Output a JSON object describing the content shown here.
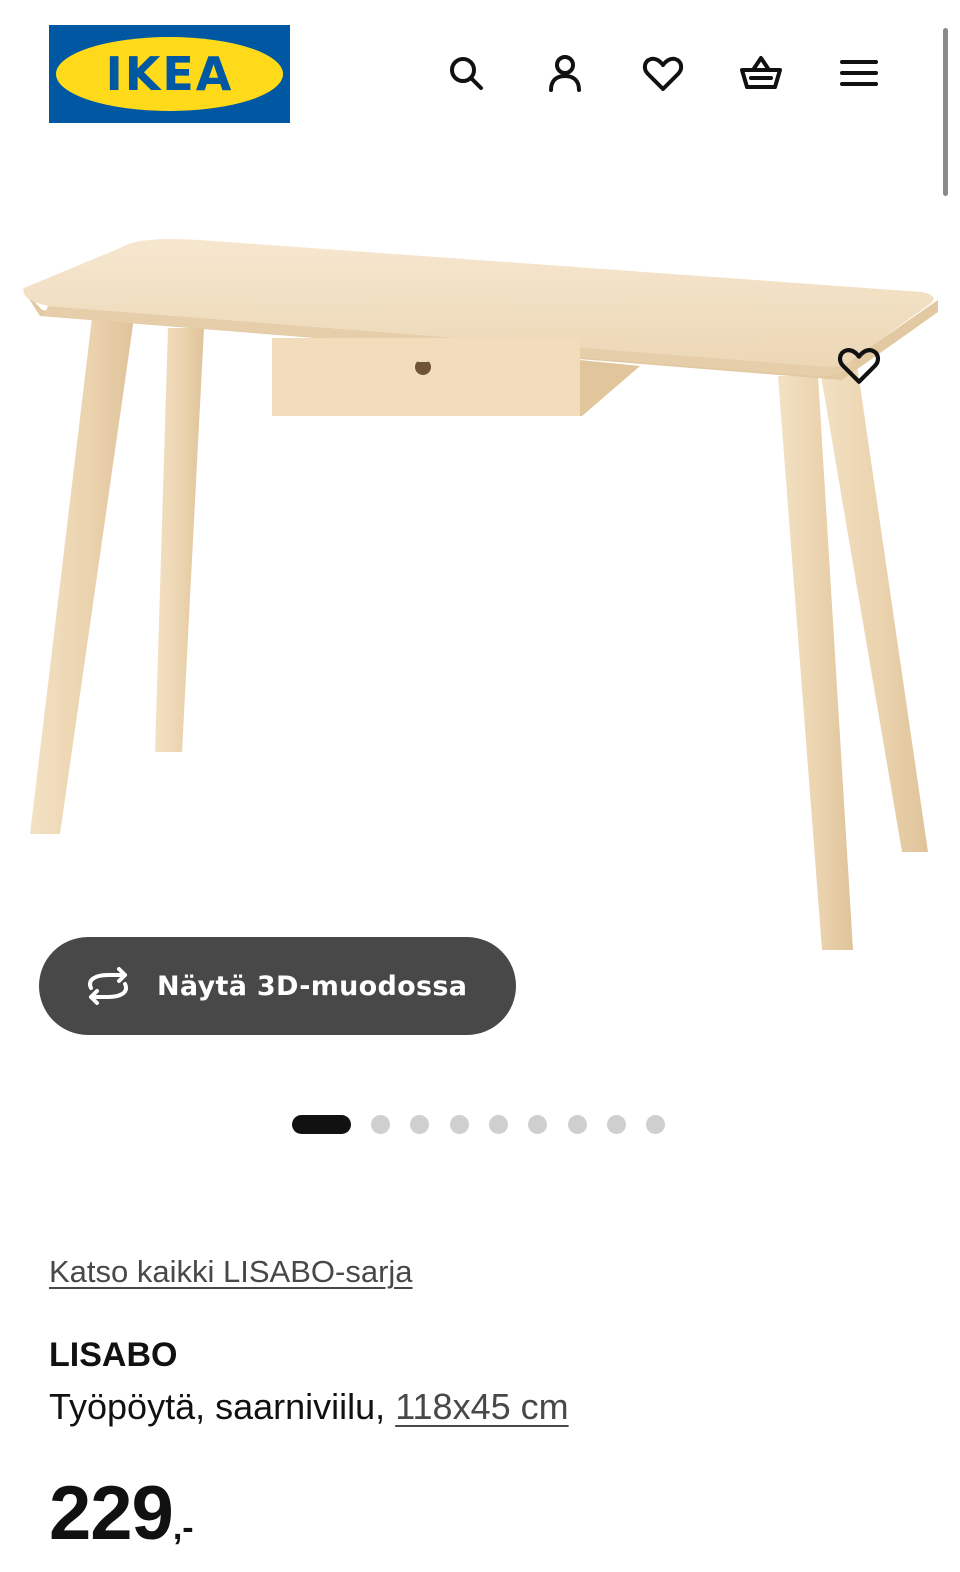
{
  "header": {
    "logo_text": "IKEA",
    "logo_reg": "®",
    "icons": [
      "search-icon",
      "user-icon",
      "heart-icon",
      "basket-icon",
      "menu-icon"
    ]
  },
  "gallery": {
    "image_alt": "LISABO desk",
    "favourite_icon": "heart-icon",
    "view_3d_label": "Näytä 3D-muodossa",
    "view_3d_icon": "rotate-icon",
    "image_count": 9,
    "current_image": 1
  },
  "product": {
    "series_link": "Katso kaikki LISABO-sarja",
    "name": "LISABO",
    "description": "Työpöytä, saarniviilu,",
    "size": "118x45 cm",
    "price_integer": "229",
    "price_suffix": ",-"
  },
  "colors": {
    "brand_blue": "#0058a3",
    "brand_yellow": "#ffda1a",
    "button_dark": "#484848",
    "wood": "#f2dfc2"
  }
}
